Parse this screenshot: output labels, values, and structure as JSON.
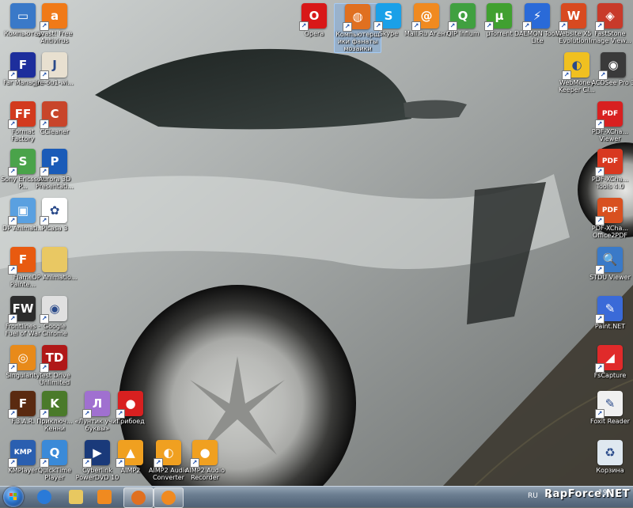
{
  "desktop_icons": [
    {
      "id": "computer",
      "label": "Компьютер",
      "icon": "computer-icon",
      "color": "#3a79c8",
      "glyph": "▭",
      "shortcut": false
    },
    {
      "id": "avast",
      "label": "avast! Free Antivirus",
      "icon": "avast-icon",
      "color": "#f07a18",
      "glyph": "a",
      "shortcut": true
    },
    {
      "id": "far",
      "label": "Far Manager",
      "icon": "far-manager-icon",
      "color": "#1d2e9c",
      "glyph": "F",
      "shortcut": true
    },
    {
      "id": "jre",
      "label": "jre-6u1-wi...",
      "icon": "java-icon",
      "color": "#e8e0d0",
      "glyph": "J",
      "shortcut": true
    },
    {
      "id": "format",
      "label": "Format Factory",
      "icon": "format-factory-icon",
      "color": "#d23a1e",
      "glyph": "FF",
      "shortcut": true
    },
    {
      "id": "ccleaner",
      "label": "CCleaner",
      "icon": "ccleaner-icon",
      "color": "#c8452a",
      "glyph": "C",
      "shortcut": true
    },
    {
      "id": "sony",
      "label": "Sony Ericsson P...",
      "icon": "sony-ericsson-icon",
      "color": "#4aa34a",
      "glyph": "S",
      "shortcut": true
    },
    {
      "id": "aurora",
      "label": "Aurora 3D Presentati...",
      "icon": "aurora-3d-icon",
      "color": "#1a5bb8",
      "glyph": "P",
      "shortcut": true
    },
    {
      "id": "dp1",
      "label": "DP Animati...",
      "icon": "dp-animation-icon",
      "color": "#5aa0e0",
      "glyph": "▣",
      "shortcut": true
    },
    {
      "id": "picasa",
      "label": "Picasa 3",
      "icon": "picasa-icon",
      "color": "#ffffff",
      "glyph": "✿",
      "shortcut": true
    },
    {
      "id": "flame",
      "label": "Flame Painte...",
      "icon": "flame-painter-icon",
      "color": "#e85a10",
      "glyph": "F",
      "shortcut": true
    },
    {
      "id": "dp2",
      "label": "DP Animatio...",
      "icon": "folder-icon",
      "color": "#e9c863",
      "glyph": "",
      "shortcut": false
    },
    {
      "id": "frontlines",
      "label": "Frontlines - Fuel of War",
      "icon": "frontlines-icon",
      "color": "#2c2c2c",
      "glyph": "FW",
      "shortcut": true
    },
    {
      "id": "chrome",
      "label": "Google Chrome",
      "icon": "chrome-icon",
      "color": "#e0e0e0",
      "glyph": "◉",
      "shortcut": true
    },
    {
      "id": "singularity",
      "label": "Singularity",
      "icon": "singularity-icon",
      "color": "#e88a1a",
      "glyph": "◎",
      "shortcut": true
    },
    {
      "id": "testdrive",
      "label": "Test Drive Unlimited",
      "icon": "test-drive-icon",
      "color": "#b01818",
      "glyph": "TD",
      "shortcut": true
    },
    {
      "id": "fear",
      "label": "F.3.A.R.",
      "icon": "fear-icon",
      "color": "#5a2a10",
      "glyph": "F",
      "shortcut": true
    },
    {
      "id": "kenny",
      "label": "Приключ... Кенни",
      "icon": "kenny-icon",
      "color": "#4a7a2a",
      "glyph": "K",
      "shortcut": true
    },
    {
      "id": "luntik",
      "label": "«Лунтик учит буквы»",
      "icon": "luntik-icon",
      "color": "#a070d0",
      "glyph": "Л",
      "shortcut": true
    },
    {
      "id": "griboed",
      "label": "Грибоед",
      "icon": "mushroom-icon",
      "color": "#d82020",
      "glyph": "●",
      "shortcut": true
    },
    {
      "id": "kmplayer",
      "label": "KMPlayer",
      "icon": "kmplayer-icon",
      "color": "#2a5fb0",
      "glyph": "KMP",
      "shortcut": true
    },
    {
      "id": "quicktime",
      "label": "QuickTime Player",
      "icon": "quicktime-icon",
      "color": "#3a8ad8",
      "glyph": "Q",
      "shortcut": true
    },
    {
      "id": "powerdvd",
      "label": "Cyberlink PowerDVD 10",
      "icon": "powerdvd-icon",
      "color": "#1a3a7a",
      "glyph": "▶",
      "shortcut": true
    },
    {
      "id": "aimp2",
      "label": "AIMP2",
      "icon": "aimp-icon",
      "color": "#f0a020",
      "glyph": "▲",
      "shortcut": true
    },
    {
      "id": "aimp2conv",
      "label": "AIMP2 Audio Converter",
      "icon": "aimp-converter-icon",
      "color": "#f0a020",
      "glyph": "◐",
      "shortcut": true
    },
    {
      "id": "aimp2rec",
      "label": "AIMP2 Audio Recorder",
      "icon": "aimp-recorder-icon",
      "color": "#f0a020",
      "glyph": "●",
      "shortcut": true
    },
    {
      "id": "opera",
      "label": "Opera",
      "icon": "opera-icon",
      "color": "#d81818",
      "glyph": "O",
      "shortcut": true
    },
    {
      "id": "firefox",
      "label": "Компьютерщики фанаты мозаики",
      "icon": "firefox-icon",
      "color": "#e07020",
      "glyph": "◍",
      "shortcut": true,
      "selected": true
    },
    {
      "id": "skype",
      "label": "Skype",
      "icon": "skype-icon",
      "color": "#1aa0e8",
      "glyph": "S",
      "shortcut": true
    },
    {
      "id": "mailru",
      "label": "Mail.Ru Агент",
      "icon": "mailru-agent-icon",
      "color": "#f08a20",
      "glyph": "@",
      "shortcut": true
    },
    {
      "id": "qip",
      "label": "QIP Infium",
      "icon": "qip-icon",
      "color": "#40a040",
      "glyph": "Q",
      "shortcut": true
    },
    {
      "id": "utorrent",
      "label": "µTorrent",
      "icon": "utorrent-icon",
      "color": "#40a030",
      "glyph": "µ",
      "shortcut": true
    },
    {
      "id": "daemon",
      "label": "DAEMON Tools Lite",
      "icon": "daemon-tools-icon",
      "color": "#2a6ad8",
      "glyph": "⚡",
      "shortcut": true
    },
    {
      "id": "website",
      "label": "Website X5 Evolution",
      "icon": "website-x5-icon",
      "color": "#d84a20",
      "glyph": "W",
      "shortcut": true
    },
    {
      "id": "faststone",
      "label": "FastStone Image View...",
      "icon": "faststone-icon",
      "color": "#c83a2a",
      "glyph": "◈",
      "shortcut": true
    },
    {
      "id": "webmoney",
      "label": "WebMoney Keeper Cl...",
      "icon": "webmoney-icon",
      "color": "#f0c020",
      "glyph": "◐",
      "shortcut": true
    },
    {
      "id": "acdsee",
      "label": "ACDSee Pro 3",
      "icon": "acdsee-icon",
      "color": "#3a3a3a",
      "glyph": "◉",
      "shortcut": true
    },
    {
      "id": "pdfviewer",
      "label": "PDF-XCha... Viewer",
      "icon": "pdf-xchange-viewer-icon",
      "color": "#d82020",
      "glyph": "PDF",
      "shortcut": true
    },
    {
      "id": "pdftools",
      "label": "PDF-XCha... Tools 4.0",
      "icon": "pdf-xchange-tools-icon",
      "color": "#d83820",
      "glyph": "PDF",
      "shortcut": true
    },
    {
      "id": "pdfoffice",
      "label": "PDF-XCha... Office2PDF",
      "icon": "pdf-xchange-office-icon",
      "color": "#d85020",
      "glyph": "PDF",
      "shortcut": true
    },
    {
      "id": "stdu",
      "label": "STDU Viewer",
      "icon": "stdu-viewer-icon",
      "color": "#3a7ac8",
      "glyph": "🔍",
      "shortcut": true
    },
    {
      "id": "paintnet",
      "label": "Paint.NET",
      "icon": "paint-net-icon",
      "color": "#3a6ad8",
      "glyph": "✎",
      "shortcut": true
    },
    {
      "id": "fscapture",
      "label": "FsCapture",
      "icon": "fscapture-icon",
      "color": "#e02a2a",
      "glyph": "◢",
      "shortcut": true
    },
    {
      "id": "foxit",
      "label": "Foxit Reader",
      "icon": "foxit-reader-icon",
      "color": "#f0f0f0",
      "glyph": "✎",
      "shortcut": true
    },
    {
      "id": "recycle",
      "label": "Корзина",
      "icon": "recycle-bin-icon",
      "color": "#dfe8f0",
      "glyph": "♻",
      "shortcut": false
    }
  ],
  "taskbar": {
    "pinned": [
      {
        "id": "ie",
        "icon": "internet-explorer-icon",
        "color": "#2a7ad8"
      },
      {
        "id": "explorer",
        "icon": "explorer-folder-icon",
        "color": "#e8c860"
      },
      {
        "id": "wmp",
        "icon": "media-player-icon",
        "color": "#f08a20"
      },
      {
        "id": "firefox",
        "icon": "firefox-icon",
        "color": "#e07020",
        "active": true
      },
      {
        "id": "mailru",
        "icon": "mailru-agent-icon",
        "color": "#f08a20",
        "active": true
      }
    ],
    "language": "RU",
    "clock": "19:0",
    "watermark": "RapForce.NET"
  }
}
